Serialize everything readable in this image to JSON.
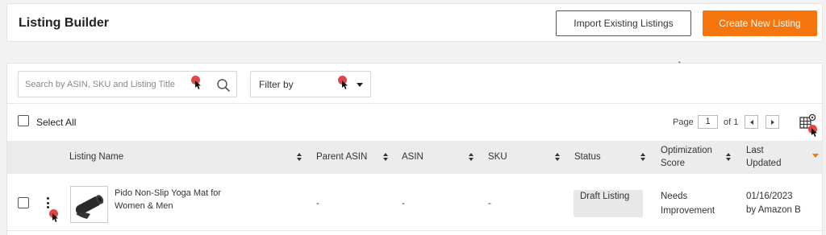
{
  "header": {
    "title": "Listing Builder",
    "import_label": "Import Existing Listings",
    "create_label": "Create New Listing"
  },
  "toolbar": {
    "search_placeholder": "Search by ASIN, SKU and Listing Title",
    "filter_label": "Filter by"
  },
  "list_controls": {
    "select_all_label": "Select All",
    "page_label": "Page",
    "page_value": "1",
    "of_label": "of 1"
  },
  "table": {
    "columns": [
      {
        "label": "Listing Name"
      },
      {
        "label": "Parent ASIN"
      },
      {
        "label": "ASIN"
      },
      {
        "label": "SKU"
      },
      {
        "label": "Status"
      },
      {
        "label": "Optimization Score"
      },
      {
        "label": "Last Updated"
      }
    ],
    "rows": [
      {
        "listing_name": "Pido Non-Slip Yoga Mat for Women & Men",
        "parent_asin": "-",
        "asin": "-",
        "sku": "-",
        "status": "Draft Listing",
        "optimization_score": "Needs Improvement",
        "last_updated_date": "01/16/2023",
        "last_updated_by": "by Amazon B"
      }
    ]
  },
  "colors": {
    "accent": "#f5760f",
    "marker": "#e04848"
  },
  "icons": [
    "search-icon",
    "chevron-down-icon",
    "chevron-left-icon",
    "chevron-right-icon",
    "column-settings-icon",
    "more-vertical-icon",
    "sort-icon",
    "sort-descending-icon",
    "product-thumbnail"
  ]
}
